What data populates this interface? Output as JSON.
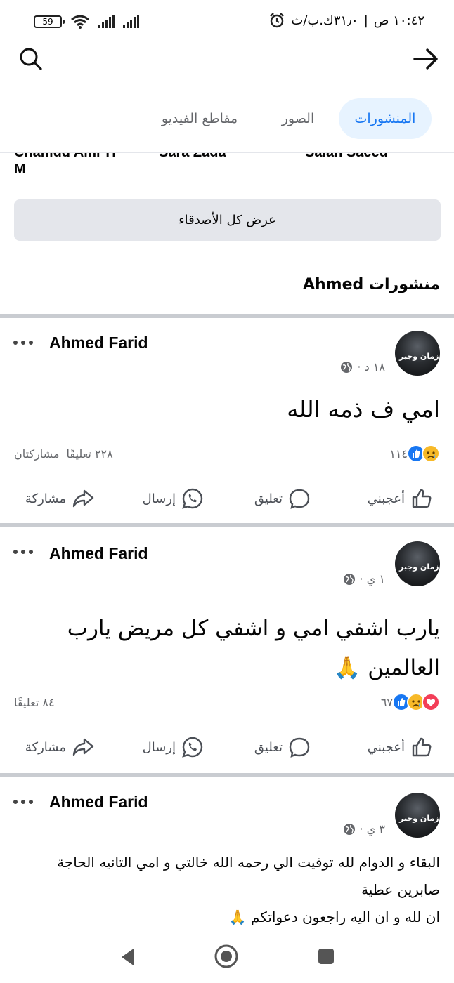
{
  "status_bar": {
    "time": "١٠:٤٢ ص",
    "data_speed": "٣١٫٠ك.ب/ث",
    "battery_level": "59"
  },
  "header": {
    "search_icon": "search-icon",
    "back_icon": "arrow-right-icon"
  },
  "tabs": [
    {
      "label": "المنشورات",
      "active": true
    },
    {
      "label": "الصور",
      "active": false
    },
    {
      "label": "مقاطع الفيديو",
      "active": false
    }
  ],
  "friends": {
    "names": [
      "Chamdd Amr H",
      "Sara Zada",
      "Salah Saeed"
    ],
    "name_wrap": "M",
    "see_all_label": "عرض كل الأصدقاء"
  },
  "section_title": "منشورات Ahmed",
  "posts": [
    {
      "author": "Ahmed Farid",
      "time": "١٨ د ·",
      "text": "امي ف ذمه الله",
      "reaction_count": "١١٤",
      "reactions": [
        "like",
        "sad"
      ],
      "comments": "٢٢٨ تعليقًا",
      "shares": "مشاركتان",
      "actions": {
        "like": "أعجبني",
        "comment": "تعليق",
        "send": "إرسال",
        "share": "مشاركة"
      }
    },
    {
      "author": "Ahmed Farid",
      "time": "١ ي ·",
      "text": "يارب اشفي امي و اشفي كل مريض يارب العالمين 🙏",
      "reaction_count": "٦٧",
      "reactions": [
        "like",
        "sad",
        "love"
      ],
      "comments": "٨٤ تعليقًا",
      "shares": "",
      "actions": {
        "like": "أعجبني",
        "comment": "تعليق",
        "send": "إرسال",
        "share": "مشاركة"
      }
    },
    {
      "author": "Ahmed Farid",
      "time": "٣ ي ·",
      "text": "البقاء و الدوام لله توفيت الي رحمه الله خالتي و امي التانيه الحاجة صابرين عطية\nان لله و ان اليه راجعون دعواتكم 🙏",
      "avatar_caption": "زمان وجبر"
    }
  ],
  "colors": {
    "accent": "#1877f2",
    "tab_active_bg": "#e7f3ff",
    "divider": "#c9ccd1",
    "button_bg": "#e4e6eb",
    "secondary_text": "#65676b"
  }
}
